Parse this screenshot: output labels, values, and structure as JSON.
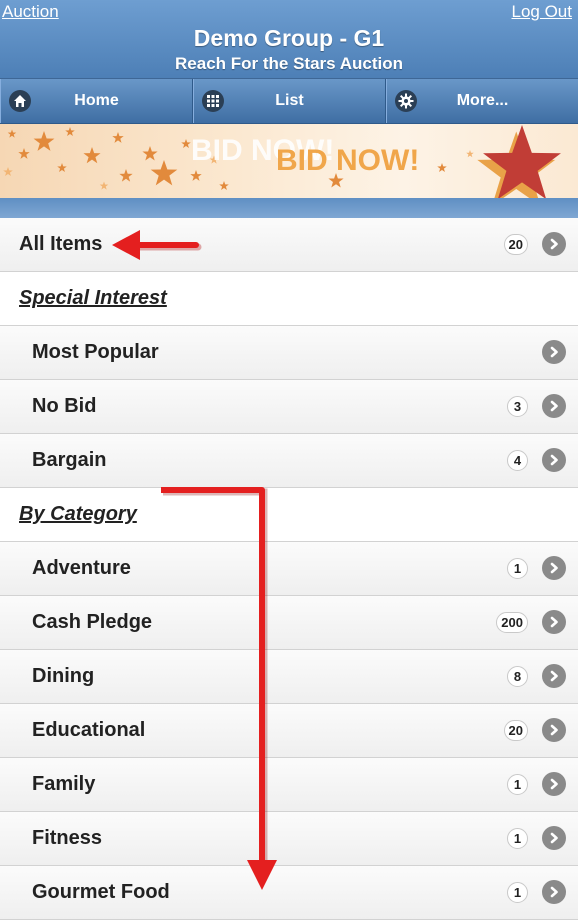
{
  "header": {
    "back_label": "Auction",
    "logout_label": "Log Out",
    "title": "Demo Group - G1",
    "subtitle": "Reach For the Stars Auction"
  },
  "nav": [
    {
      "label": "Home",
      "icon": "home-icon"
    },
    {
      "label": "List",
      "icon": "grid-icon"
    },
    {
      "label": "More...",
      "icon": "gear-icon"
    }
  ],
  "banner": {
    "text_ghost": "BID NOW!",
    "text": "BID NOW!"
  },
  "list": {
    "rows": [
      {
        "label": "All Items",
        "count": "20",
        "type": "item",
        "level": 0
      },
      {
        "label": "Special Interest",
        "count": "",
        "type": "divider"
      },
      {
        "label": "Most Popular",
        "count": "",
        "type": "item",
        "level": 1
      },
      {
        "label": "No Bid",
        "count": "3",
        "type": "item",
        "level": 1
      },
      {
        "label": "Bargain",
        "count": "4",
        "type": "item",
        "level": 1
      },
      {
        "label": "By Category",
        "count": "",
        "type": "divider"
      },
      {
        "label": "Adventure",
        "count": "1",
        "type": "item",
        "level": 1
      },
      {
        "label": "Cash Pledge",
        "count": "200",
        "type": "item",
        "level": 1
      },
      {
        "label": "Dining",
        "count": "8",
        "type": "item",
        "level": 1
      },
      {
        "label": "Educational",
        "count": "20",
        "type": "item",
        "level": 1
      },
      {
        "label": "Family",
        "count": "1",
        "type": "item",
        "level": 1
      },
      {
        "label": "Fitness",
        "count": "1",
        "type": "item",
        "level": 1
      },
      {
        "label": "Gourmet Food",
        "count": "1",
        "type": "item",
        "level": 1
      }
    ]
  },
  "colors": {
    "header": "#5b8ec6",
    "annotation_arrow": "#e41f1f",
    "banner_star": "#c8453a",
    "banner_text": "#f0a64a"
  }
}
